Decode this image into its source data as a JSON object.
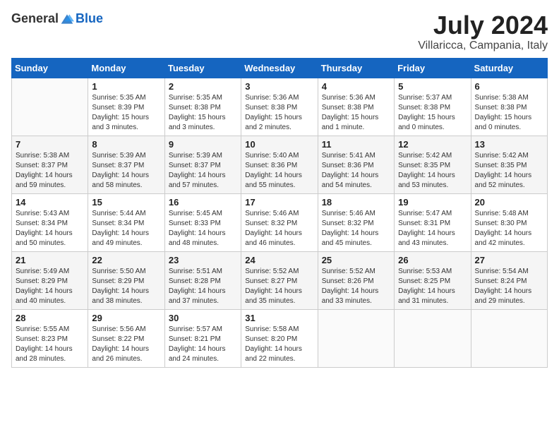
{
  "logo": {
    "general": "General",
    "blue": "Blue"
  },
  "title": "July 2024",
  "location": "Villaricca, Campania, Italy",
  "days_of_week": [
    "Sunday",
    "Monday",
    "Tuesday",
    "Wednesday",
    "Thursday",
    "Friday",
    "Saturday"
  ],
  "weeks": [
    [
      {
        "day": "",
        "sunrise": "",
        "sunset": "",
        "daylight": ""
      },
      {
        "day": "1",
        "sunrise": "Sunrise: 5:35 AM",
        "sunset": "Sunset: 8:39 PM",
        "daylight": "Daylight: 15 hours and 3 minutes."
      },
      {
        "day": "2",
        "sunrise": "Sunrise: 5:35 AM",
        "sunset": "Sunset: 8:38 PM",
        "daylight": "Daylight: 15 hours and 3 minutes."
      },
      {
        "day": "3",
        "sunrise": "Sunrise: 5:36 AM",
        "sunset": "Sunset: 8:38 PM",
        "daylight": "Daylight: 15 hours and 2 minutes."
      },
      {
        "day": "4",
        "sunrise": "Sunrise: 5:36 AM",
        "sunset": "Sunset: 8:38 PM",
        "daylight": "Daylight: 15 hours and 1 minute."
      },
      {
        "day": "5",
        "sunrise": "Sunrise: 5:37 AM",
        "sunset": "Sunset: 8:38 PM",
        "daylight": "Daylight: 15 hours and 0 minutes."
      },
      {
        "day": "6",
        "sunrise": "Sunrise: 5:38 AM",
        "sunset": "Sunset: 8:38 PM",
        "daylight": "Daylight: 15 hours and 0 minutes."
      }
    ],
    [
      {
        "day": "7",
        "sunrise": "Sunrise: 5:38 AM",
        "sunset": "Sunset: 8:37 PM",
        "daylight": "Daylight: 14 hours and 59 minutes."
      },
      {
        "day": "8",
        "sunrise": "Sunrise: 5:39 AM",
        "sunset": "Sunset: 8:37 PM",
        "daylight": "Daylight: 14 hours and 58 minutes."
      },
      {
        "day": "9",
        "sunrise": "Sunrise: 5:39 AM",
        "sunset": "Sunset: 8:37 PM",
        "daylight": "Daylight: 14 hours and 57 minutes."
      },
      {
        "day": "10",
        "sunrise": "Sunrise: 5:40 AM",
        "sunset": "Sunset: 8:36 PM",
        "daylight": "Daylight: 14 hours and 55 minutes."
      },
      {
        "day": "11",
        "sunrise": "Sunrise: 5:41 AM",
        "sunset": "Sunset: 8:36 PM",
        "daylight": "Daylight: 14 hours and 54 minutes."
      },
      {
        "day": "12",
        "sunrise": "Sunrise: 5:42 AM",
        "sunset": "Sunset: 8:35 PM",
        "daylight": "Daylight: 14 hours and 53 minutes."
      },
      {
        "day": "13",
        "sunrise": "Sunrise: 5:42 AM",
        "sunset": "Sunset: 8:35 PM",
        "daylight": "Daylight: 14 hours and 52 minutes."
      }
    ],
    [
      {
        "day": "14",
        "sunrise": "Sunrise: 5:43 AM",
        "sunset": "Sunset: 8:34 PM",
        "daylight": "Daylight: 14 hours and 50 minutes."
      },
      {
        "day": "15",
        "sunrise": "Sunrise: 5:44 AM",
        "sunset": "Sunset: 8:34 PM",
        "daylight": "Daylight: 14 hours and 49 minutes."
      },
      {
        "day": "16",
        "sunrise": "Sunrise: 5:45 AM",
        "sunset": "Sunset: 8:33 PM",
        "daylight": "Daylight: 14 hours and 48 minutes."
      },
      {
        "day": "17",
        "sunrise": "Sunrise: 5:46 AM",
        "sunset": "Sunset: 8:32 PM",
        "daylight": "Daylight: 14 hours and 46 minutes."
      },
      {
        "day": "18",
        "sunrise": "Sunrise: 5:46 AM",
        "sunset": "Sunset: 8:32 PM",
        "daylight": "Daylight: 14 hours and 45 minutes."
      },
      {
        "day": "19",
        "sunrise": "Sunrise: 5:47 AM",
        "sunset": "Sunset: 8:31 PM",
        "daylight": "Daylight: 14 hours and 43 minutes."
      },
      {
        "day": "20",
        "sunrise": "Sunrise: 5:48 AM",
        "sunset": "Sunset: 8:30 PM",
        "daylight": "Daylight: 14 hours and 42 minutes."
      }
    ],
    [
      {
        "day": "21",
        "sunrise": "Sunrise: 5:49 AM",
        "sunset": "Sunset: 8:29 PM",
        "daylight": "Daylight: 14 hours and 40 minutes."
      },
      {
        "day": "22",
        "sunrise": "Sunrise: 5:50 AM",
        "sunset": "Sunset: 8:29 PM",
        "daylight": "Daylight: 14 hours and 38 minutes."
      },
      {
        "day": "23",
        "sunrise": "Sunrise: 5:51 AM",
        "sunset": "Sunset: 8:28 PM",
        "daylight": "Daylight: 14 hours and 37 minutes."
      },
      {
        "day": "24",
        "sunrise": "Sunrise: 5:52 AM",
        "sunset": "Sunset: 8:27 PM",
        "daylight": "Daylight: 14 hours and 35 minutes."
      },
      {
        "day": "25",
        "sunrise": "Sunrise: 5:52 AM",
        "sunset": "Sunset: 8:26 PM",
        "daylight": "Daylight: 14 hours and 33 minutes."
      },
      {
        "day": "26",
        "sunrise": "Sunrise: 5:53 AM",
        "sunset": "Sunset: 8:25 PM",
        "daylight": "Daylight: 14 hours and 31 minutes."
      },
      {
        "day": "27",
        "sunrise": "Sunrise: 5:54 AM",
        "sunset": "Sunset: 8:24 PM",
        "daylight": "Daylight: 14 hours and 29 minutes."
      }
    ],
    [
      {
        "day": "28",
        "sunrise": "Sunrise: 5:55 AM",
        "sunset": "Sunset: 8:23 PM",
        "daylight": "Daylight: 14 hours and 28 minutes."
      },
      {
        "day": "29",
        "sunrise": "Sunrise: 5:56 AM",
        "sunset": "Sunset: 8:22 PM",
        "daylight": "Daylight: 14 hours and 26 minutes."
      },
      {
        "day": "30",
        "sunrise": "Sunrise: 5:57 AM",
        "sunset": "Sunset: 8:21 PM",
        "daylight": "Daylight: 14 hours and 24 minutes."
      },
      {
        "day": "31",
        "sunrise": "Sunrise: 5:58 AM",
        "sunset": "Sunset: 8:20 PM",
        "daylight": "Daylight: 14 hours and 22 minutes."
      },
      {
        "day": "",
        "sunrise": "",
        "sunset": "",
        "daylight": ""
      },
      {
        "day": "",
        "sunrise": "",
        "sunset": "",
        "daylight": ""
      },
      {
        "day": "",
        "sunrise": "",
        "sunset": "",
        "daylight": ""
      }
    ]
  ]
}
